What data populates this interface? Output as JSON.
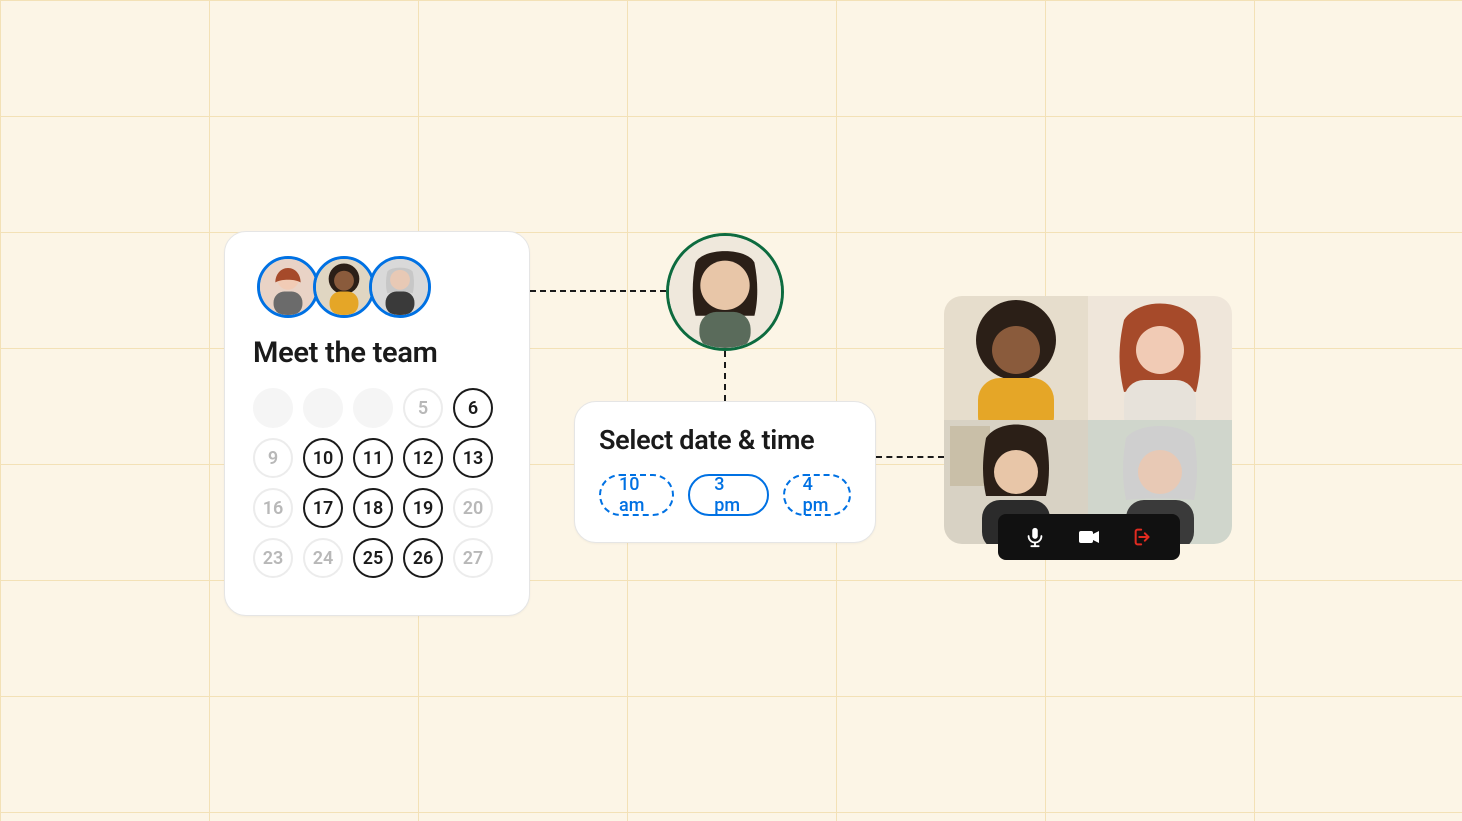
{
  "team_card": {
    "title": "Meet the team",
    "avatars": [
      "avatar-1",
      "avatar-2",
      "avatar-3"
    ],
    "calendar": {
      "rows": [
        [
          {
            "label": "",
            "state": "blank"
          },
          {
            "label": "",
            "state": "blank"
          },
          {
            "label": "",
            "state": "blank"
          },
          {
            "label": "5",
            "state": "disabled"
          },
          {
            "label": "6",
            "state": "avail"
          }
        ],
        [
          {
            "label": "9",
            "state": "disabled"
          },
          {
            "label": "10",
            "state": "avail"
          },
          {
            "label": "11",
            "state": "avail"
          },
          {
            "label": "12",
            "state": "avail"
          },
          {
            "label": "13",
            "state": "avail"
          }
        ],
        [
          {
            "label": "16",
            "state": "disabled"
          },
          {
            "label": "17",
            "state": "avail"
          },
          {
            "label": "18",
            "state": "avail"
          },
          {
            "label": "19",
            "state": "avail"
          },
          {
            "label": "20",
            "state": "disabled"
          }
        ],
        [
          {
            "label": "23",
            "state": "disabled"
          },
          {
            "label": "24",
            "state": "disabled"
          },
          {
            "label": "25",
            "state": "avail"
          },
          {
            "label": "26",
            "state": "avail"
          },
          {
            "label": "27",
            "state": "disabled"
          }
        ]
      ]
    }
  },
  "invitee": {
    "avatar": "avatar-invitee"
  },
  "time_card": {
    "title": "Select date & time",
    "options": [
      {
        "label": "10 am",
        "selected": false
      },
      {
        "label": "3 pm",
        "selected": true
      },
      {
        "label": "4 pm",
        "selected": false
      }
    ]
  },
  "video_call": {
    "participants": [
      "participant-1",
      "participant-2",
      "participant-3",
      "participant-4"
    ],
    "controls": {
      "mic": {
        "icon": "mic-icon",
        "color": "#ffffff"
      },
      "camera": {
        "icon": "camera-icon",
        "color": "#ffffff"
      },
      "leave": {
        "icon": "leave-icon",
        "color": "#e02b20"
      }
    }
  }
}
